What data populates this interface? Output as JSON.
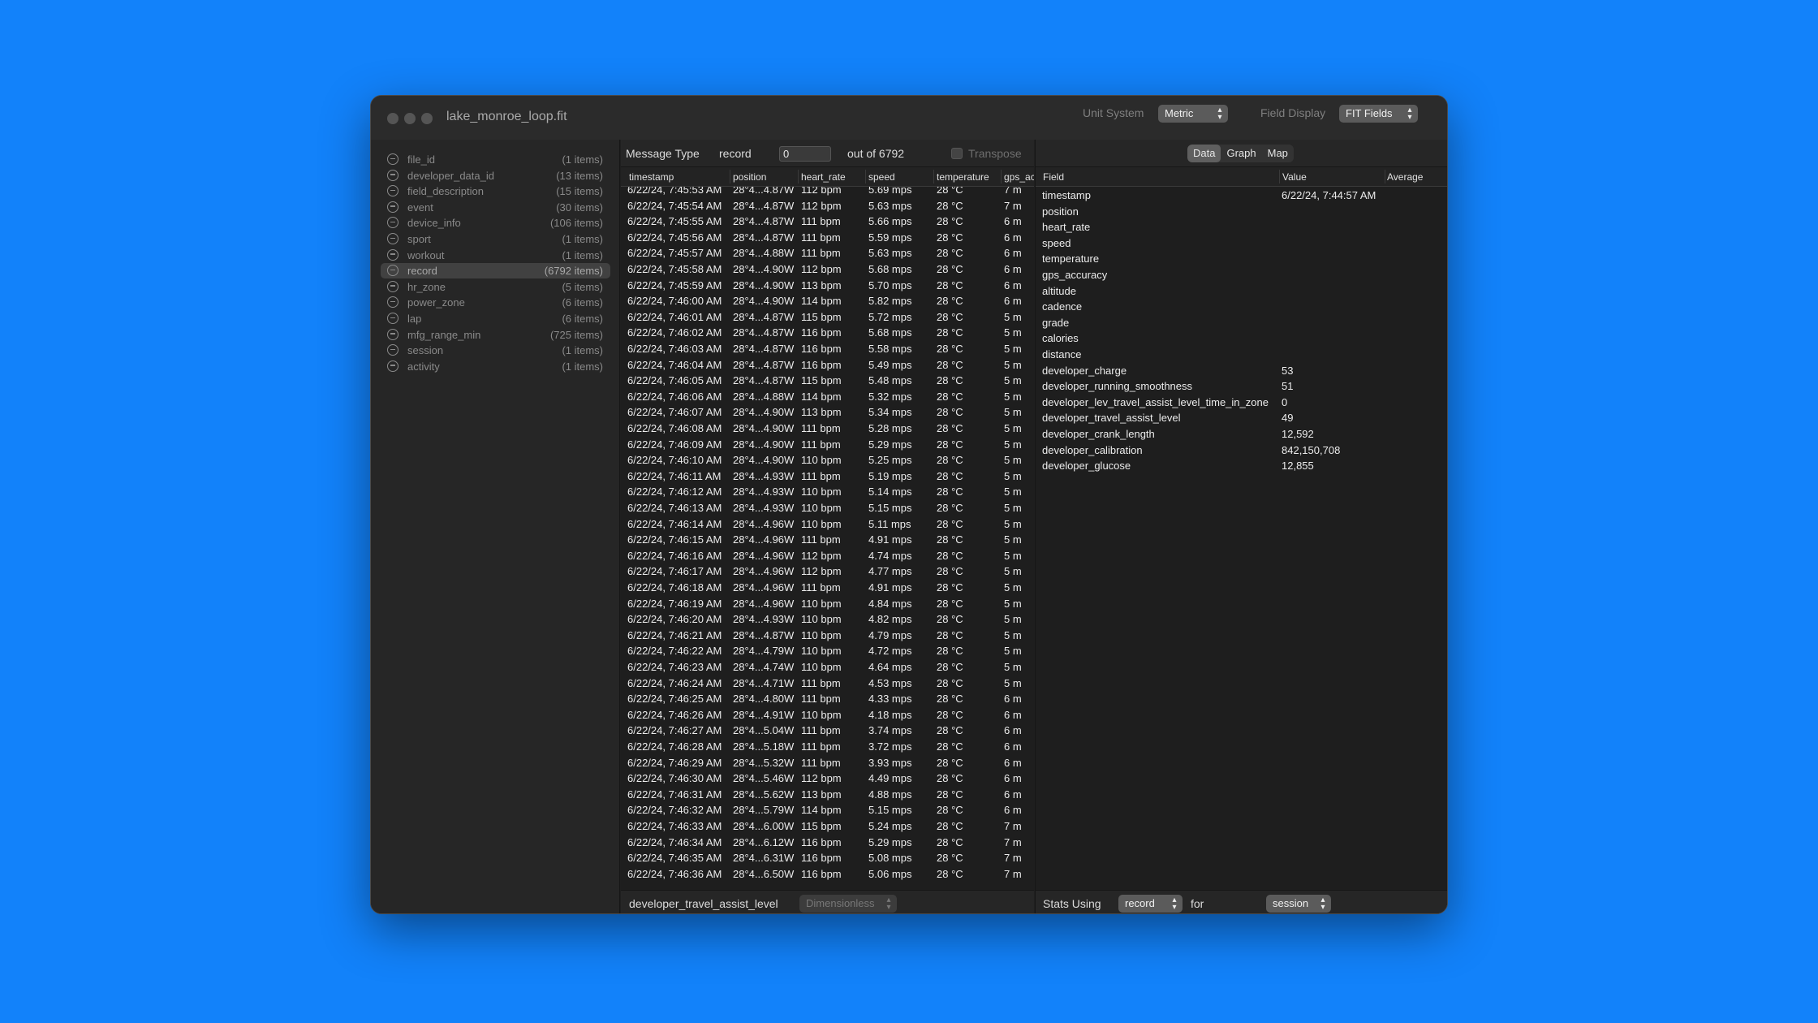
{
  "window": {
    "title": "lake_monroe_loop.fit",
    "unit_system_label": "Unit System",
    "unit_system_value": "Metric",
    "field_display_label": "Field Display",
    "field_display_value": "FIT Fields"
  },
  "sidebar": {
    "items": [
      {
        "label": "file_id",
        "count": "(1 items)"
      },
      {
        "label": "developer_data_id",
        "count": "(13 items)"
      },
      {
        "label": "field_description",
        "count": "(15 items)"
      },
      {
        "label": "event",
        "count": "(30 items)"
      },
      {
        "label": "device_info",
        "count": "(106 items)"
      },
      {
        "label": "sport",
        "count": "(1 items)"
      },
      {
        "label": "workout",
        "count": "(1 items)"
      },
      {
        "label": "record",
        "count": "(6792 items)",
        "selected": true
      },
      {
        "label": "hr_zone",
        "count": "(5 items)"
      },
      {
        "label": "power_zone",
        "count": "(6 items)"
      },
      {
        "label": "lap",
        "count": "(6 items)"
      },
      {
        "label": "mfg_range_min",
        "count": "(725 items)"
      },
      {
        "label": "session",
        "count": "(1 items)"
      },
      {
        "label": "activity",
        "count": "(1 items)"
      }
    ]
  },
  "message_panel": {
    "message_type_label": "Message Type",
    "message_type_value": "record",
    "index_value": "0",
    "out_of": "out of 6792",
    "transpose_label": "Transpose",
    "columns": [
      "timestamp",
      "position",
      "heart_rate",
      "speed",
      "temperature",
      "gps_ac"
    ],
    "rows": [
      [
        "6/22/24, 7:45:53 AM",
        "28°4...4.87W",
        "112 bpm",
        "5.69 mps",
        "28 °C",
        "7 m"
      ],
      [
        "6/22/24, 7:45:54 AM",
        "28°4...4.87W",
        "112 bpm",
        "5.63 mps",
        "28 °C",
        "7 m"
      ],
      [
        "6/22/24, 7:45:55 AM",
        "28°4...4.87W",
        "111 bpm",
        "5.66 mps",
        "28 °C",
        "6 m"
      ],
      [
        "6/22/24, 7:45:56 AM",
        "28°4...4.87W",
        "111 bpm",
        "5.59 mps",
        "28 °C",
        "6 m"
      ],
      [
        "6/22/24, 7:45:57 AM",
        "28°4...4.88W",
        "111 bpm",
        "5.63 mps",
        "28 °C",
        "6 m"
      ],
      [
        "6/22/24, 7:45:58 AM",
        "28°4...4.90W",
        "112 bpm",
        "5.68 mps",
        "28 °C",
        "6 m"
      ],
      [
        "6/22/24, 7:45:59 AM",
        "28°4...4.90W",
        "113 bpm",
        "5.70 mps",
        "28 °C",
        "6 m"
      ],
      [
        "6/22/24, 7:46:00 AM",
        "28°4...4.90W",
        "114 bpm",
        "5.82 mps",
        "28 °C",
        "6 m"
      ],
      [
        "6/22/24, 7:46:01 AM",
        "28°4...4.87W",
        "115 bpm",
        "5.72 mps",
        "28 °C",
        "5 m"
      ],
      [
        "6/22/24, 7:46:02 AM",
        "28°4...4.87W",
        "116 bpm",
        "5.68 mps",
        "28 °C",
        "5 m"
      ],
      [
        "6/22/24, 7:46:03 AM",
        "28°4...4.87W",
        "116 bpm",
        "5.58 mps",
        "28 °C",
        "5 m"
      ],
      [
        "6/22/24, 7:46:04 AM",
        "28°4...4.87W",
        "116 bpm",
        "5.49 mps",
        "28 °C",
        "5 m"
      ],
      [
        "6/22/24, 7:46:05 AM",
        "28°4...4.87W",
        "115 bpm",
        "5.48 mps",
        "28 °C",
        "5 m"
      ],
      [
        "6/22/24, 7:46:06 AM",
        "28°4...4.88W",
        "114 bpm",
        "5.32 mps",
        "28 °C",
        "5 m"
      ],
      [
        "6/22/24, 7:46:07 AM",
        "28°4...4.90W",
        "113 bpm",
        "5.34 mps",
        "28 °C",
        "5 m"
      ],
      [
        "6/22/24, 7:46:08 AM",
        "28°4...4.90W",
        "111 bpm",
        "5.28 mps",
        "28 °C",
        "5 m"
      ],
      [
        "6/22/24, 7:46:09 AM",
        "28°4...4.90W",
        "111 bpm",
        "5.29 mps",
        "28 °C",
        "5 m"
      ],
      [
        "6/22/24, 7:46:10 AM",
        "28°4...4.90W",
        "110 bpm",
        "5.25 mps",
        "28 °C",
        "5 m"
      ],
      [
        "6/22/24, 7:46:11 AM",
        "28°4...4.93W",
        "111 bpm",
        "5.19 mps",
        "28 °C",
        "5 m"
      ],
      [
        "6/22/24, 7:46:12 AM",
        "28°4...4.93W",
        "110 bpm",
        "5.14 mps",
        "28 °C",
        "5 m"
      ],
      [
        "6/22/24, 7:46:13 AM",
        "28°4...4.93W",
        "110 bpm",
        "5.15 mps",
        "28 °C",
        "5 m"
      ],
      [
        "6/22/24, 7:46:14 AM",
        "28°4...4.96W",
        "110 bpm",
        "5.11 mps",
        "28 °C",
        "5 m"
      ],
      [
        "6/22/24, 7:46:15 AM",
        "28°4...4.96W",
        "111 bpm",
        "4.91 mps",
        "28 °C",
        "5 m"
      ],
      [
        "6/22/24, 7:46:16 AM",
        "28°4...4.96W",
        "112 bpm",
        "4.74 mps",
        "28 °C",
        "5 m"
      ],
      [
        "6/22/24, 7:46:17 AM",
        "28°4...4.96W",
        "112 bpm",
        "4.77 mps",
        "28 °C",
        "5 m"
      ],
      [
        "6/22/24, 7:46:18 AM",
        "28°4...4.96W",
        "111 bpm",
        "4.91 mps",
        "28 °C",
        "5 m"
      ],
      [
        "6/22/24, 7:46:19 AM",
        "28°4...4.96W",
        "110 bpm",
        "4.84 mps",
        "28 °C",
        "5 m"
      ],
      [
        "6/22/24, 7:46:20 AM",
        "28°4...4.93W",
        "110 bpm",
        "4.82 mps",
        "28 °C",
        "5 m"
      ],
      [
        "6/22/24, 7:46:21 AM",
        "28°4...4.87W",
        "110 bpm",
        "4.79 mps",
        "28 °C",
        "5 m"
      ],
      [
        "6/22/24, 7:46:22 AM",
        "28°4...4.79W",
        "110 bpm",
        "4.72 mps",
        "28 °C",
        "5 m"
      ],
      [
        "6/22/24, 7:46:23 AM",
        "28°4...4.74W",
        "110 bpm",
        "4.64 mps",
        "28 °C",
        "5 m"
      ],
      [
        "6/22/24, 7:46:24 AM",
        "28°4...4.71W",
        "111 bpm",
        "4.53 mps",
        "28 °C",
        "5 m"
      ],
      [
        "6/22/24, 7:46:25 AM",
        "28°4...4.80W",
        "111 bpm",
        "4.33 mps",
        "28 °C",
        "6 m"
      ],
      [
        "6/22/24, 7:46:26 AM",
        "28°4...4.91W",
        "110 bpm",
        "4.18 mps",
        "28 °C",
        "6 m"
      ],
      [
        "6/22/24, 7:46:27 AM",
        "28°4...5.04W",
        "111 bpm",
        "3.74 mps",
        "28 °C",
        "6 m"
      ],
      [
        "6/22/24, 7:46:28 AM",
        "28°4...5.18W",
        "111 bpm",
        "3.72 mps",
        "28 °C",
        "6 m"
      ],
      [
        "6/22/24, 7:46:29 AM",
        "28°4...5.32W",
        "111 bpm",
        "3.93 mps",
        "28 °C",
        "6 m"
      ],
      [
        "6/22/24, 7:46:30 AM",
        "28°4...5.46W",
        "112 bpm",
        "4.49 mps",
        "28 °C",
        "6 m"
      ],
      [
        "6/22/24, 7:46:31 AM",
        "28°4...5.62W",
        "113 bpm",
        "4.88 mps",
        "28 °C",
        "6 m"
      ],
      [
        "6/22/24, 7:46:32 AM",
        "28°4...5.79W",
        "114 bpm",
        "5.15 mps",
        "28 °C",
        "6 m"
      ],
      [
        "6/22/24, 7:46:33 AM",
        "28°4...6.00W",
        "115 bpm",
        "5.24 mps",
        "28 °C",
        "7 m"
      ],
      [
        "6/22/24, 7:46:34 AM",
        "28°4...6.12W",
        "116 bpm",
        "5.29 mps",
        "28 °C",
        "7 m"
      ],
      [
        "6/22/24, 7:46:35 AM",
        "28°4...6.31W",
        "116 bpm",
        "5.08 mps",
        "28 °C",
        "7 m"
      ],
      [
        "6/22/24, 7:46:36 AM",
        "28°4...6.50W",
        "116 bpm",
        "5.06 mps",
        "28 °C",
        "7 m"
      ]
    ],
    "footer_field": "developer_travel_assist_level",
    "footer_unit": "Dimensionless"
  },
  "detail_panel": {
    "tabs": [
      {
        "label": "Data",
        "active": true
      },
      {
        "label": "Graph"
      },
      {
        "label": "Map"
      }
    ],
    "columns": [
      "Field",
      "Value",
      "Average"
    ],
    "fields": [
      {
        "field": "timestamp",
        "value": "6/22/24, 7:44:57 AM"
      },
      {
        "field": "position",
        "value": ""
      },
      {
        "field": "heart_rate",
        "value": ""
      },
      {
        "field": "speed",
        "value": ""
      },
      {
        "field": "temperature",
        "value": ""
      },
      {
        "field": "gps_accuracy",
        "value": ""
      },
      {
        "field": "altitude",
        "value": ""
      },
      {
        "field": "cadence",
        "value": ""
      },
      {
        "field": "grade",
        "value": ""
      },
      {
        "field": "calories",
        "value": ""
      },
      {
        "field": "distance",
        "value": ""
      },
      {
        "field": "developer_charge",
        "value": "53"
      },
      {
        "field": "developer_running_smoothness",
        "value": "51"
      },
      {
        "field": "developer_lev_travel_assist_level_time_in_zone",
        "value": "0"
      },
      {
        "field": "developer_travel_assist_level",
        "value": "49"
      },
      {
        "field": "developer_crank_length",
        "value": "12,592"
      },
      {
        "field": "developer_calibration",
        "value": "842,150,708"
      },
      {
        "field": "developer_glucose",
        "value": "12,855"
      }
    ],
    "stats_label": "Stats Using",
    "stats_value": "record",
    "for_label": "for",
    "for_value": "session"
  }
}
